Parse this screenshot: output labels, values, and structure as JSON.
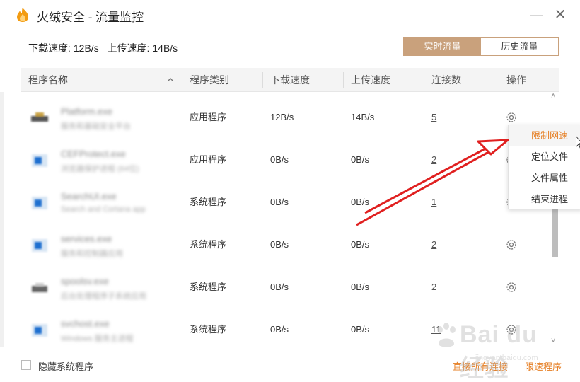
{
  "window": {
    "title": "火绒安全 - 流量监控",
    "minimize_glyph": "—",
    "close_glyph": "✕",
    "brand_color": "#e67e22",
    "accent_color": "#c9a17c"
  },
  "speed": {
    "download_label": "下载速度:",
    "download_value": "12B/s",
    "upload_label": "上传速度:",
    "upload_value": "14B/s"
  },
  "tabs": [
    {
      "label": "实时流量",
      "active": true
    },
    {
      "label": "历史流量",
      "active": false
    }
  ],
  "columns": [
    "程序名称",
    "程序类别",
    "下载速度",
    "上传速度",
    "连接数",
    "操作"
  ],
  "rows": [
    {
      "name": "Platform.exe",
      "desc": "服务和基础安全平台",
      "icon": "hardware-icon",
      "category": "应用程序",
      "down": "12B/s",
      "up": "14B/s",
      "connections": "5"
    },
    {
      "name": "CEFProtect.exe",
      "desc": "浏览器保护进程 (64位)",
      "icon": "app-icon",
      "category": "应用程序",
      "down": "0B/s",
      "up": "0B/s",
      "connections": "2"
    },
    {
      "name": "SearchUI.exe",
      "desc": "Search and Cortana app",
      "icon": "app-icon",
      "category": "系统程序",
      "down": "0B/s",
      "up": "0B/s",
      "connections": "1"
    },
    {
      "name": "services.exe",
      "desc": "服务和控制器应用",
      "icon": "app-icon",
      "category": "系统程序",
      "down": "0B/s",
      "up": "0B/s",
      "connections": "2"
    },
    {
      "name": "spoolsv.exe",
      "desc": "后台处理程序子系统应用",
      "icon": "printer-icon",
      "category": "系统程序",
      "down": "0B/s",
      "up": "0B/s",
      "connections": "2"
    },
    {
      "name": "svchost.exe",
      "desc": "Windows 服务主进程",
      "icon": "app-icon",
      "category": "系统程序",
      "down": "0B/s",
      "up": "0B/s",
      "connections": "11"
    }
  ],
  "context_menu": [
    "限制网速",
    "定位文件",
    "文件属性",
    "结束进程"
  ],
  "footer": {
    "hide_system_label": "隐藏系统程序",
    "link_a": "直接所有连接",
    "link_b": "限速程序"
  },
  "watermark": {
    "text": "Bai du 经验",
    "sub": "jingyan.baidu.com"
  }
}
